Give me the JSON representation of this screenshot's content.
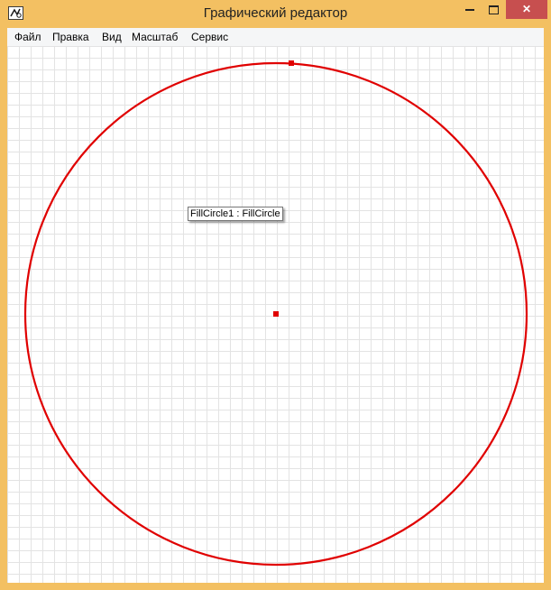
{
  "window": {
    "title": "Графический редактор",
    "minimize_icon": "minimize-icon",
    "maximize_icon": "maximize-icon",
    "close_icon": "close-icon",
    "close_symbol": "✕"
  },
  "menu": {
    "items": [
      "Файл",
      "Правка",
      "Вид",
      "Масштаб",
      "Сервис"
    ]
  },
  "canvas": {
    "grid_color": "#e3e3e3",
    "shape": {
      "type": "circle",
      "stroke_color": "#e00000",
      "handle_color": "#e00000"
    },
    "tooltip": "FillCircle1 : FillCircle"
  },
  "colors": {
    "frame": "#f3c062",
    "close_button": "#c74f4f",
    "menubar": "#f5f6f7"
  }
}
